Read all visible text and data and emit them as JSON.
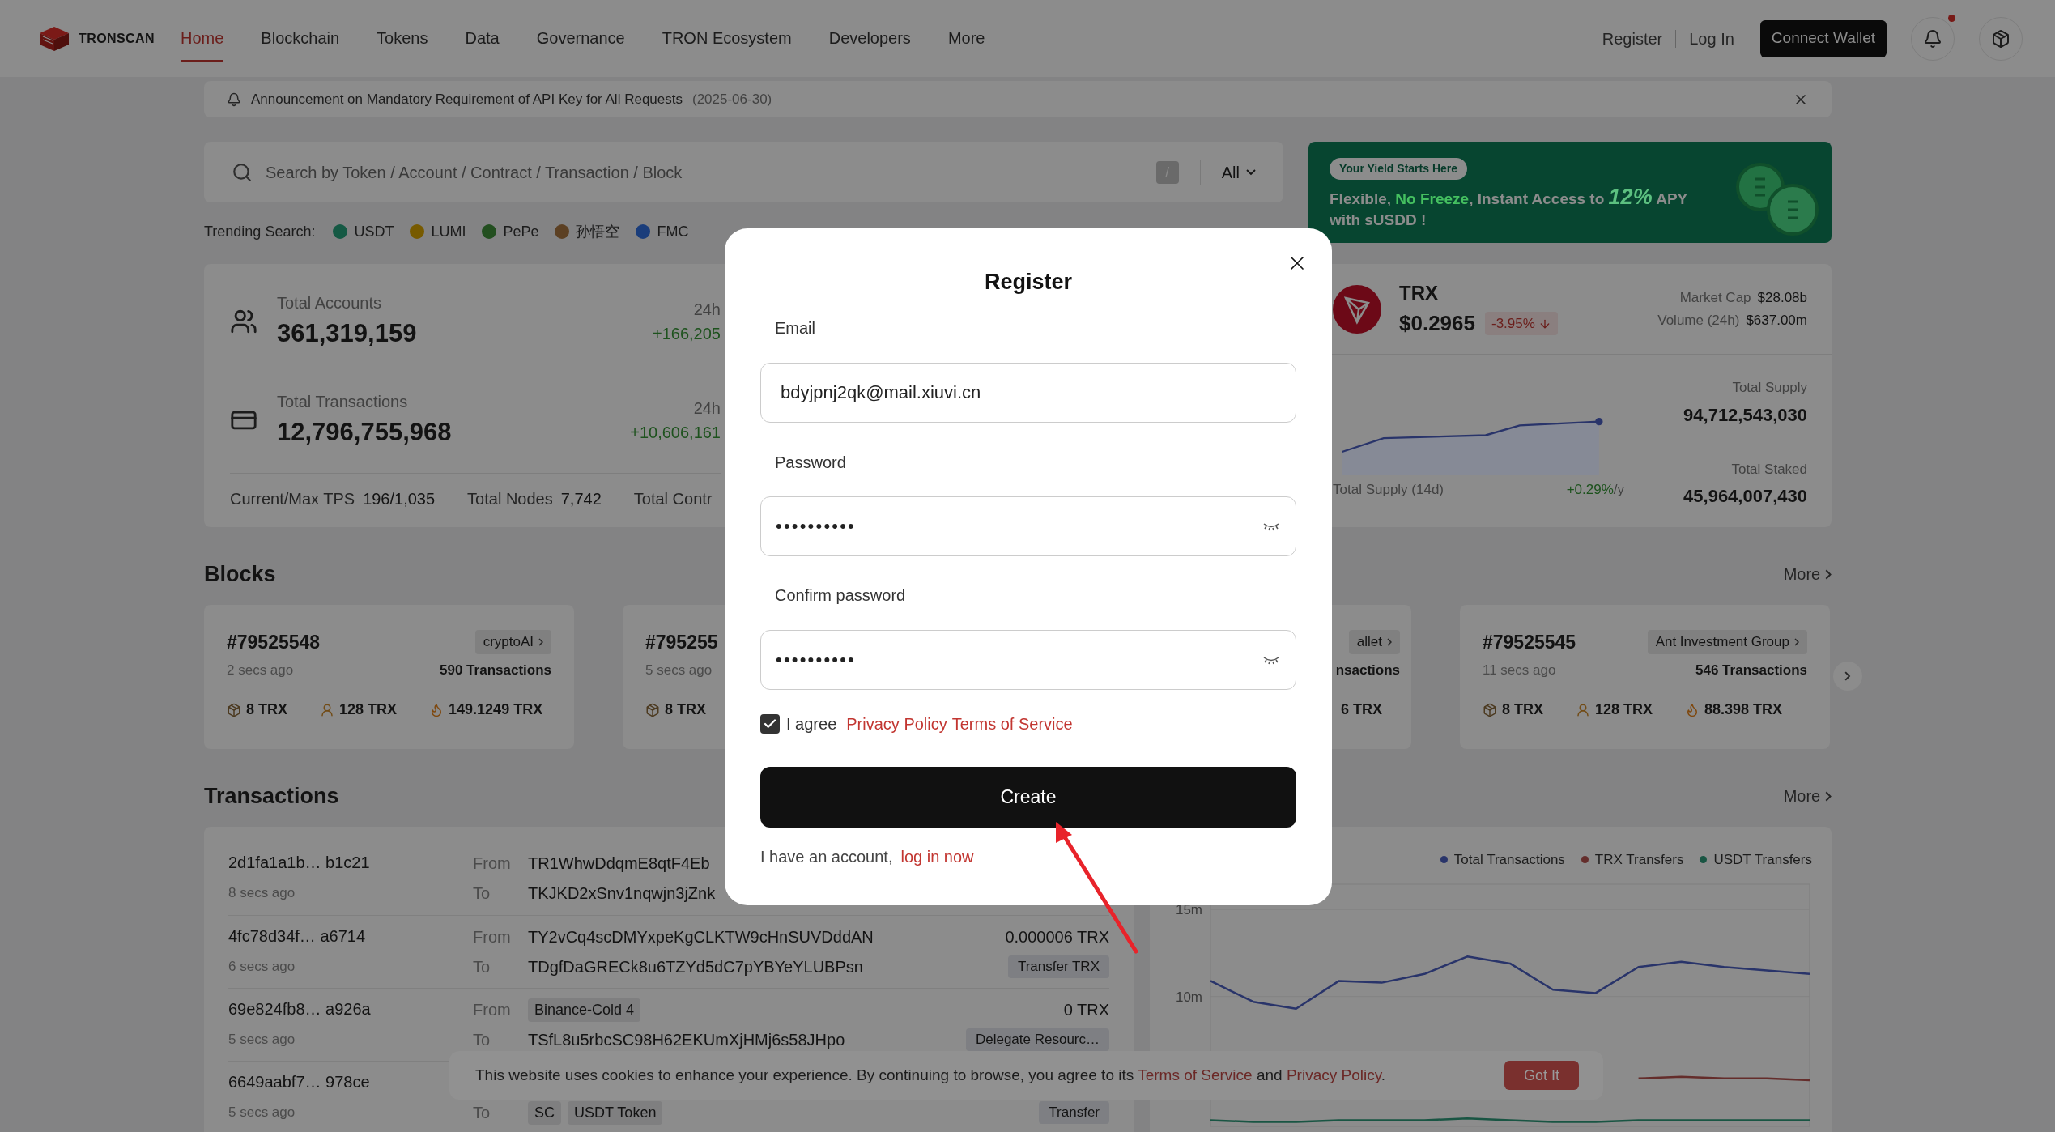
{
  "header": {
    "logo": "TRONSCAN",
    "nav": [
      {
        "label": "Home",
        "selected": true
      },
      {
        "label": "Blockchain",
        "selected": false
      },
      {
        "label": "Tokens",
        "selected": false
      },
      {
        "label": "Data",
        "selected": false
      },
      {
        "label": "Governance",
        "selected": false
      },
      {
        "label": "TRON Ecosystem",
        "selected": false
      },
      {
        "label": "Developers",
        "selected": false
      },
      {
        "label": "More",
        "selected": false
      }
    ],
    "register": "Register",
    "login": "Log In",
    "connect": "Connect Wallet",
    "unread": true
  },
  "announcement": {
    "text": "Announcement on Mandatory Requirement of API Key for All Requests",
    "date": "(2025-06-30)"
  },
  "search": {
    "placeholder": "Search by Token / Account / Contract / Transaction / Block",
    "shortcut": "/",
    "filter": "All"
  },
  "trending": {
    "label": "Trending Search:",
    "items": [
      {
        "name": "USDT",
        "color": "#155944"
      },
      {
        "name": "LUMI",
        "color": "#775a00"
      },
      {
        "name": "PePe",
        "color": "#234f20"
      },
      {
        "name": "孙悟空",
        "color": "#5c4023"
      },
      {
        "name": "FMC",
        "color": "#1a3d7b"
      }
    ]
  },
  "banner": {
    "tag": "Your Yield Starts Here",
    "headline": [
      {
        "kind": "plain",
        "text": "Flexible, "
      },
      {
        "kind": "accent",
        "text": "No Freeze"
      },
      {
        "kind": "plain",
        "text": ", Instant Access to "
      },
      {
        "kind": "big",
        "text": "12%"
      },
      {
        "kind": "plain",
        "text": " APY"
      }
    ],
    "subline": "with sUSDD !"
  },
  "stats": {
    "rows": [
      {
        "kind": "accounts",
        "label": "Total Accounts",
        "value": "361,319,159",
        "period": "24h",
        "change": "+166,205"
      },
      {
        "kind": "transactions",
        "label": "Total Transactions",
        "value": "12,796,755,968",
        "period": "24h",
        "change": "+10,606,161"
      }
    ],
    "footer": [
      {
        "label": "Current/Max TPS",
        "value": "196/1,035"
      },
      {
        "label": "Total Nodes",
        "value": "7,742"
      },
      {
        "label": "Total Contr"
      }
    ]
  },
  "trx": {
    "name": "TRX",
    "price": "$0.2965",
    "change": "-3.95%",
    "falling": true,
    "market_cap_label": "Market Cap",
    "market_cap": "$28.08b",
    "volume_label": "Volume (24h)",
    "volume": "$637.00m",
    "supply_chart_label": "Total Supply (14d)",
    "supply_rate": "+0.29%",
    "supply_rate_unit": "/y",
    "supply_label": "Total Supply",
    "supply": "94,712,543,030",
    "staked_label": "Total Staked",
    "staked": "45,964,007,430"
  },
  "blocks": {
    "title": "Blocks",
    "more": "More",
    "cards": [
      {
        "number": "#79525548",
        "producer": "cryptoAI",
        "age": "2 secs ago",
        "txs": "590 Transactions",
        "fees": [
          {
            "kind": "bandwidth",
            "text": "8 TRX"
          },
          {
            "kind": "energy",
            "text": "128 TRX"
          },
          {
            "kind": "burn",
            "text": "149.1249 TRX"
          }
        ]
      },
      {
        "number": "#795255",
        "age": "5 secs ago",
        "fees": [
          {
            "kind": "bandwidth",
            "text": "8 TRX"
          }
        ]
      },
      {
        "producer": "allet",
        "txs": "nsactions",
        "fees": [
          {
            "kind": "cut",
            "text": "6 TRX"
          }
        ]
      },
      {
        "number": "#79525545",
        "producer": "Ant Investment Group",
        "age": "11 secs ago",
        "txs": "546 Transactions",
        "fees": [
          {
            "kind": "bandwidth",
            "text": "8 TRX"
          },
          {
            "kind": "energy",
            "text": "128 TRX"
          },
          {
            "kind": "burn",
            "text": "88.398 TRX"
          }
        ]
      }
    ]
  },
  "transactions": {
    "title": "Transactions",
    "more": "More",
    "rows": [
      {
        "hash": "2d1fa1a1b… b1c21",
        "age": "8 secs ago",
        "from_label": "From",
        "from": {
          "kind": "address",
          "text": "TR1WhwDdqmE8qtF4Eb"
        },
        "to_label": "To",
        "to": {
          "kind": "address",
          "text": "TKJKD2xSnv1nqwjn3jZnk"
        }
      },
      {
        "hash": "4fc78d34f… a6714",
        "age": "6 secs ago",
        "from_label": "From",
        "from": {
          "kind": "address",
          "text": "TY2vCq4scDMYxpeKgCLKTW9cHnSUVDddAN"
        },
        "to_label": "To",
        "to": {
          "kind": "address",
          "text": "TDgfDaGRECk8u6TZYd5dC7pYBYeYLUBPsn"
        },
        "amount": "0.000006 TRX",
        "type": "Transfer TRX"
      },
      {
        "hash": "69e824fb8… a926a",
        "age": "5 secs ago",
        "from_label": "From",
        "from": {
          "kind": "tags",
          "tags": [
            "Binance-Cold 4"
          ]
        },
        "to_label": "To",
        "to": {
          "kind": "address",
          "text": "TSfL8u5rbcSC98H62EKUmXjHMj6s58JHpo"
        },
        "amount": "0 TRX",
        "type": "Delegate Resourc…"
      },
      {
        "hash": "6649aabf7… 978ce",
        "age": "5 secs ago",
        "to_label": "To",
        "to": {
          "kind": "tags",
          "tags": [
            "SC",
            "USDT Token"
          ]
        },
        "type": "Transfer"
      }
    ]
  },
  "tx_chart": {
    "chart_data": {
      "type": "line",
      "ylim": [
        2500000,
        16500000
      ],
      "yticks": [
        {
          "value": 10000000,
          "label": "10m"
        },
        {
          "value": 15000000,
          "label": "15m"
        }
      ],
      "series": [
        {
          "name": "Total Transactions",
          "color": "#29346a",
          "values": [
            10900000,
            9700000,
            9300000,
            10900000,
            10800000,
            11300000,
            12300000,
            11900000,
            10400000,
            10200000,
            11700000,
            12000000,
            11700000,
            11500000,
            11300000
          ]
        },
        {
          "name": "TRX Transfers",
          "color": "#642d2b",
          "values": [
            null,
            null,
            null,
            null,
            null,
            null,
            null,
            null,
            null,
            null,
            5300000,
            5400000,
            5300000,
            5300000,
            5200000
          ]
        },
        {
          "name": "USDT Transfers",
          "color": "#195543",
          "values": [
            2900000,
            2800000,
            2800000,
            2900000,
            2900000,
            2900000,
            3000000,
            2900000,
            2800000,
            2800000,
            2900000,
            2900000,
            2900000,
            2900000,
            2900000
          ]
        }
      ]
    }
  },
  "cookie": {
    "text": "This website uses cookies to enhance your experience. By continuing to browse, you agree to its",
    "terms": "Terms of Service",
    "and": "and",
    "privacy": "Privacy Policy",
    "end": ".",
    "button": "Got It"
  },
  "modal": {
    "title": "Register",
    "email_label": "Email",
    "email": "bdyjpnj2qk@mail.xiuvi.cn",
    "password_label": "Password",
    "password": "••••••••••",
    "confirm_label": "Confirm password",
    "confirm": "••••••••••",
    "agree": "I agree",
    "agree_checked": true,
    "privacy": "Privacy Policy",
    "terms": "Terms of Service",
    "create": "Create",
    "have_account": "I have an account,",
    "login_link": "log in now"
  }
}
